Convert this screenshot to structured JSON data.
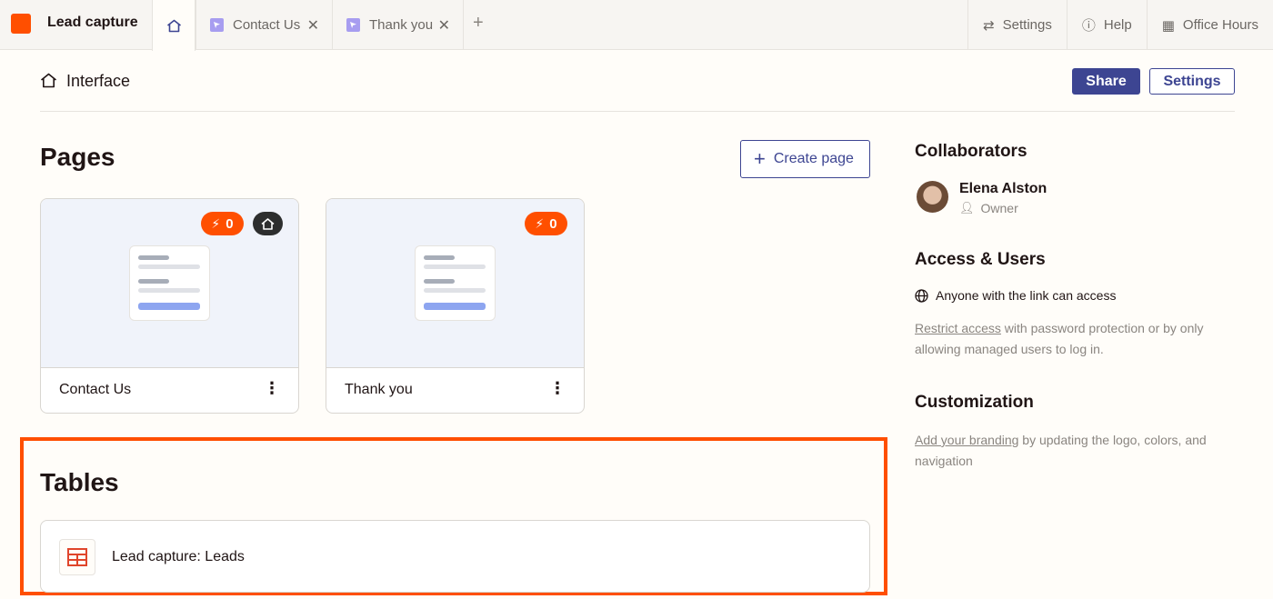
{
  "app": {
    "title": "Lead capture",
    "brand_color": "#ff4f00"
  },
  "tabs": [
    {
      "label": "Contact Us"
    },
    {
      "label": "Thank you"
    }
  ],
  "top_nav": {
    "settings": "Settings",
    "help": "Help",
    "office_hours": "Office Hours"
  },
  "header": {
    "title": "Interface",
    "share": "Share",
    "settings": "Settings"
  },
  "pages": {
    "heading": "Pages",
    "create_label": "Create page",
    "items": [
      {
        "name": "Contact Us",
        "zap_count": "0",
        "is_home": true
      },
      {
        "name": "Thank you",
        "zap_count": "0",
        "is_home": false
      }
    ]
  },
  "tables": {
    "heading": "Tables",
    "items": [
      {
        "name": "Lead capture: Leads"
      }
    ]
  },
  "sidebar": {
    "collaborators_heading": "Collaborators",
    "collaborator": {
      "name": "Elena Alston",
      "role": "Owner"
    },
    "access_heading": "Access & Users",
    "access_text": "Anyone with the link can access",
    "restrict_link": "Restrict access",
    "restrict_rest": " with password protection or by only allowing managed users to log in.",
    "custom_heading": "Customization",
    "branding_link": "Add your branding",
    "branding_rest": " by updating the logo, colors, and navigation"
  },
  "colors": {
    "accent": "#3d4592",
    "highlight": "#ff4f00"
  }
}
